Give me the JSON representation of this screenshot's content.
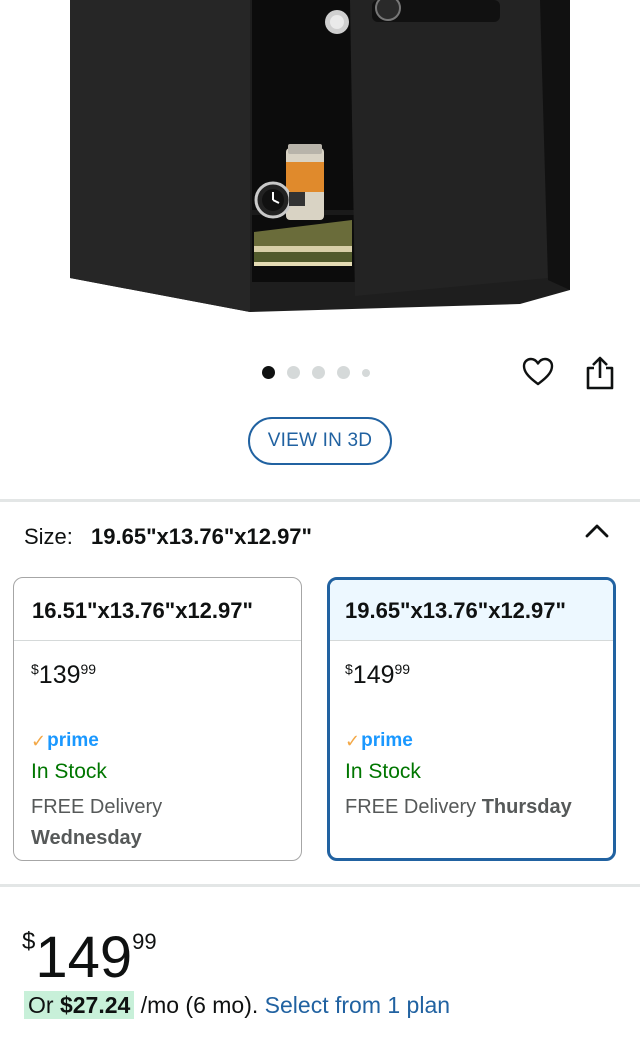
{
  "gallery": {
    "dots": [
      true,
      false,
      false,
      false,
      false
    ],
    "view_3d_label": "VIEW IN 3D"
  },
  "size": {
    "label": "Size:",
    "selected": "19.65\"x13.76\"x12.97\""
  },
  "options": [
    {
      "dimensions": "16.51\"x13.76\"x12.97\"",
      "currency": "$",
      "price_whole": "139",
      "price_fraction": "99",
      "prime": "prime",
      "stock": "In Stock",
      "delivery_prefix": "FREE Delivery",
      "delivery_day": "Wednesday",
      "selected": false
    },
    {
      "dimensions": "19.65\"x13.76\"x12.97\"",
      "currency": "$",
      "price_whole": "149",
      "price_fraction": "99",
      "prime": "prime",
      "stock": "In Stock",
      "delivery_prefix": "FREE Delivery",
      "delivery_day": "Thursday",
      "selected": true
    }
  ],
  "price": {
    "currency": "$",
    "whole": "149",
    "fraction": "99"
  },
  "installment": {
    "prefix": "Or",
    "amount": "$27.24",
    "term": "/mo (6 mo).",
    "link": "Select from 1 plan"
  },
  "colors": {
    "link": "#2162a1",
    "in_stock": "#007600",
    "prime": "#1a98ff",
    "prime_check": "#f3a847",
    "selected_border": "#2162a1",
    "installment_highlight": "#c8f0d9"
  },
  "icons": [
    "heart-icon",
    "share-icon",
    "chevron-up-icon",
    "prime-check-icon"
  ]
}
